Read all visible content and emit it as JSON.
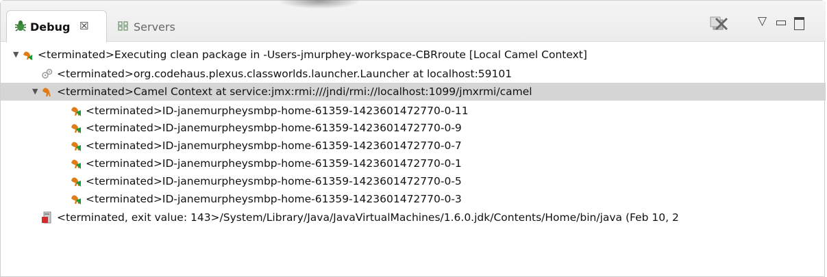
{
  "tabs": [
    {
      "label": "Debug",
      "close": "☒"
    },
    {
      "label": "Servers"
    }
  ],
  "toolbar": {
    "remove_all_icon": "remove-all-terminated-icon",
    "view_menu_glyph": "▽",
    "minimize_glyph": "▭",
    "maximize_glyph": "□"
  },
  "colors": {
    "camel_orange": "#e07b16",
    "camel_green": "#1a9a3a",
    "selection": "#d5d5d5"
  },
  "tree": [
    {
      "text": "<terminated>Executing clean package in -Users-jmurphey-workspace-CBRroute [Local Camel Context]",
      "level": 0,
      "twisty": "▼",
      "icon": "camel-launch-icon"
    },
    {
      "text": "<terminated>org.codehaus.plexus.classworlds.launcher.Launcher at localhost:59101",
      "level": 1,
      "twisty": "",
      "icon": "debug-target-icon"
    },
    {
      "text": "<terminated>Camel Context at service:jmx:rmi:///jndi/rmi://localhost:1099/jmxrmi/camel",
      "level": 1,
      "twisty": "▼",
      "icon": "camel-context-icon",
      "selected": true
    },
    {
      "text": "<terminated>ID-janemurpheysmbp-home-61359-1423601472770-0-11",
      "level": 2,
      "twisty": "",
      "icon": "camel-route-icon"
    },
    {
      "text": "<terminated>ID-janemurpheysmbp-home-61359-1423601472770-0-9",
      "level": 2,
      "twisty": "",
      "icon": "camel-route-icon"
    },
    {
      "text": "<terminated>ID-janemurpheysmbp-home-61359-1423601472770-0-7",
      "level": 2,
      "twisty": "",
      "icon": "camel-route-icon"
    },
    {
      "text": "<terminated>ID-janemurpheysmbp-home-61359-1423601472770-0-1",
      "level": 2,
      "twisty": "",
      "icon": "camel-route-icon"
    },
    {
      "text": "<terminated>ID-janemurpheysmbp-home-61359-1423601472770-0-5",
      "level": 2,
      "twisty": "",
      "icon": "camel-route-icon"
    },
    {
      "text": "<terminated>ID-janemurpheysmbp-home-61359-1423601472770-0-3",
      "level": 2,
      "twisty": "",
      "icon": "camel-route-icon"
    },
    {
      "text": "<terminated, exit value: 143>/System/Library/Java/JavaVirtualMachines/1.6.0.jdk/Contents/Home/bin/java (Feb 10, 2",
      "level": 1,
      "twisty": "",
      "icon": "process-icon"
    }
  ]
}
